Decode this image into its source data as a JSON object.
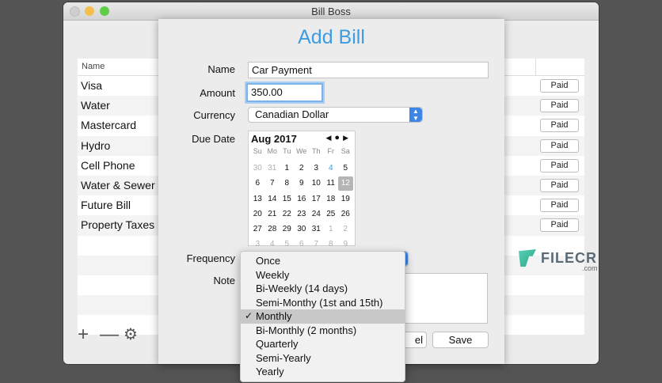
{
  "window": {
    "title": "Bill Boss"
  },
  "bill_list": {
    "column_name": "Name",
    "rows": [
      {
        "name": "Visa",
        "status": "Paid"
      },
      {
        "name": "Water",
        "status": "Paid"
      },
      {
        "name": "Mastercard",
        "status": "Paid"
      },
      {
        "name": "Hydro",
        "status": "Paid"
      },
      {
        "name": "Cell Phone",
        "status": "Paid"
      },
      {
        "name": "Water & Sewer",
        "status": "Paid"
      },
      {
        "name": "Future Bill",
        "status": "Paid"
      },
      {
        "name": "Property Taxes",
        "status": "Paid"
      }
    ]
  },
  "toolbar": {
    "add_icon": "plus-icon",
    "remove_icon": "minus-icon",
    "settings_icon": "gear-icon"
  },
  "sheet": {
    "title": "Add Bill",
    "name_label": "Name",
    "name_value": "Car Payment",
    "amount_label": "Amount",
    "amount_value": "350.00",
    "currency_label": "Currency",
    "currency_value": "Canadian Dollar",
    "due_label": "Due Date",
    "frequency_label": "Frequency",
    "note_label": "Note",
    "cancel_label": "el",
    "save_label": "Save"
  },
  "calendar": {
    "month": "Aug 2017",
    "weekdays": [
      "Su",
      "Mo",
      "Tu",
      "We",
      "Th",
      "Fr",
      "Sa"
    ],
    "weeks": [
      [
        "30",
        "31",
        "1",
        "2",
        "3",
        "4",
        "5"
      ],
      [
        "6",
        "7",
        "8",
        "9",
        "10",
        "11",
        "12"
      ],
      [
        "13",
        "14",
        "15",
        "16",
        "17",
        "18",
        "19"
      ],
      [
        "20",
        "21",
        "22",
        "23",
        "24",
        "25",
        "26"
      ],
      [
        "27",
        "28",
        "29",
        "30",
        "31",
        "1",
        "2"
      ],
      [
        "3",
        "4",
        "5",
        "6",
        "7",
        "8",
        "9"
      ]
    ],
    "today": "4",
    "selected": "12"
  },
  "frequency_menu": {
    "options": [
      "Once",
      "Weekly",
      "Bi-Weekly (14 days)",
      "Semi-Monthy (1st and 15th)",
      "Monthly",
      "Bi-Monthly (2 months)",
      "Quarterly",
      "Semi-Yearly",
      "Yearly"
    ],
    "selected": "Monthly",
    "check": "✓"
  },
  "watermark": {
    "text": "FILECR",
    "sub": ".com"
  },
  "colors": {
    "accent": "#3e9ce0",
    "popup_button": "#3e86e6"
  }
}
